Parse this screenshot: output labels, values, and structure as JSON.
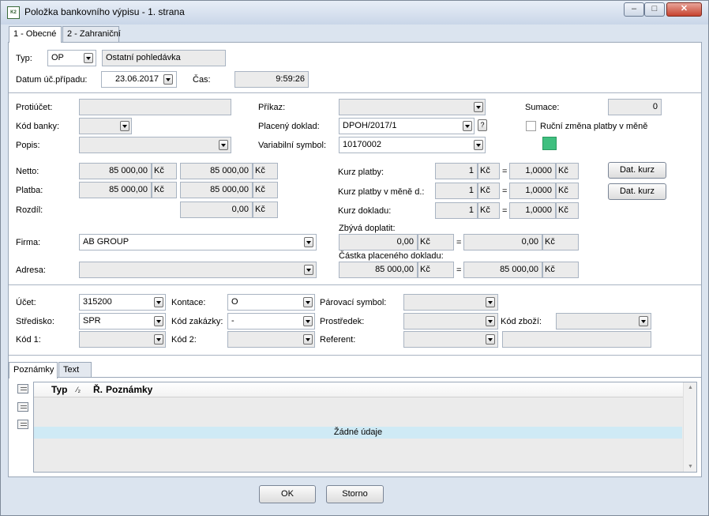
{
  "window": {
    "title": "Položka bankovního výpisu - 1. strana",
    "app_icon_text": "K2"
  },
  "tabs": [
    "1 - Obecné",
    "2 - Zahraniční"
  ],
  "header": {
    "typ_label": "Typ:",
    "typ_value": "OP",
    "typ_desc": "Ostatní pohledávka",
    "datum_label": "Datum úč.případu:",
    "datum_value": "23.06.2017",
    "cas_label": "Čas:",
    "cas_value": "9:59:26"
  },
  "left": {
    "protiucet_label": "Protiúčet:",
    "protiucet_value": "",
    "kod_banky_label": "Kód banky:",
    "kod_banky_value": "",
    "popis_label": "Popis:",
    "popis_value": "",
    "netto_label": "Netto:",
    "netto_value1": "85 000,00",
    "netto_value2": "85 000,00",
    "platba_label": "Platba:",
    "platba_value1": "85 000,00",
    "platba_value2": "85 000,00",
    "rozdil_label": "Rozdíl:",
    "rozdil_value": "0,00",
    "currency": "Kč",
    "firma_label": "Firma:",
    "firma_value": "AB GROUP",
    "adresa_label": "Adresa:",
    "adresa_value": ""
  },
  "middle": {
    "prikaz_label": "Příkaz:",
    "prikaz_value": "",
    "placeny_label": "Placený doklad:",
    "placeny_value": "DPOH/2017/1",
    "help_q": "?",
    "var_label": "Variabilní symbol:",
    "var_value": "10170002",
    "kurz_platby_label": "Kurz platby:",
    "kurz_platby_mena_label": "Kurz platby v měně d.:",
    "kurz_dokladu_label": "Kurz dokladu:",
    "kurz_amount": "1",
    "kurz_rate": "1,0000",
    "eq": "=",
    "zbyva_label": "Zbývá doplatit:",
    "zbyva_value1": "0,00",
    "zbyva_value2": "0,00",
    "castka_label": "Částka placeného dokladu:",
    "castka_value1": "85 000,00",
    "castka_value2": "85 000,00"
  },
  "right": {
    "sumace_label": "Sumace:",
    "sumace_value": "0",
    "rucni_label": "Ruční změna platby v měně",
    "rucni_checked": false,
    "dat_kurz1": "Dat. kurz",
    "dat_kurz2": "Dat. kurz",
    "status_color": "#3fbf7f"
  },
  "accounting": {
    "ucet_label": "Účet:",
    "ucet_value": "315200",
    "kontace_label": "Kontace:",
    "kontace_value": "O",
    "parovaci_label": "Párovací symbol:",
    "parovaci_value": "",
    "stredisko_label": "Středisko:",
    "stredisko_value": "SPR",
    "kod_zakazky_label": "Kód zakázky:",
    "kod_zakazky_value": "-",
    "prostredek_label": "Prostředek:",
    "prostredek_value": "",
    "kod_zbozi_label": "Kód zboží:",
    "kod_zbozi_value": "",
    "kod1_label": "Kód 1:",
    "kod1_value": "",
    "kod2_label": "Kód 2:",
    "kod2_value": "",
    "referent_label": "Referent:",
    "referent_value": "",
    "referent_extra": ""
  },
  "notes": {
    "tabs": [
      "Poznámky",
      "Text"
    ],
    "columns": [
      "Typ",
      "Ř.",
      "Poznámky"
    ],
    "sort_mark": "⁄₂",
    "empty_text": "Žádné údaje"
  },
  "footer": {
    "ok_label": "OK",
    "storno_label": "Storno"
  }
}
